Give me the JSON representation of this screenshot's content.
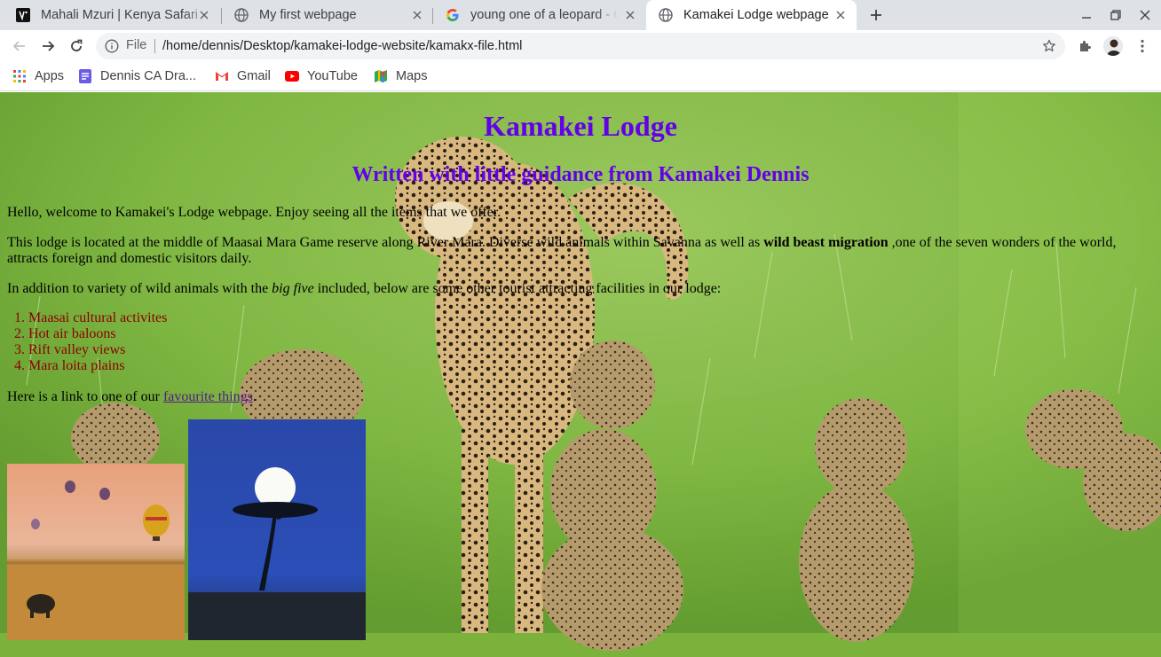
{
  "browser": {
    "tabs": [
      {
        "title": "Mahali Mzuri | Kenya Safari",
        "favicon": "virgin-favicon"
      },
      {
        "title": "My first webpage",
        "favicon": "globe-icon"
      },
      {
        "title": "young one of a leopard - Google Search",
        "favicon": "google-icon"
      },
      {
        "title": "Kamakei Lodge webpage",
        "favicon": "globe-icon",
        "active": true
      }
    ],
    "address": {
      "scheme": "File",
      "url": "/home/dennis/Desktop/kamakei-lodge-website/kamakx-file.html"
    },
    "bookmarks": [
      {
        "label": "Apps",
        "icon": "apps-grid-icon"
      },
      {
        "label": "Dennis CA Dra...",
        "icon": "docs-icon"
      },
      {
        "label": "Gmail",
        "icon": "gmail-icon"
      },
      {
        "label": "YouTube",
        "icon": "youtube-icon"
      },
      {
        "label": "Maps",
        "icon": "maps-icon"
      }
    ]
  },
  "page": {
    "heading": "Kamakei Lodge",
    "subheading": "Written with little guidance from Kamakei Dennis",
    "intro": "Hello, welcome to Kamakei's Lodge webpage. Enjoy seeing all the items that we offer.",
    "location_before": "This lodge is located at the middle of Maasai Mara Game reserve along River Mara. Diverse wild animals within Savanna as well as ",
    "location_bold": "wild beast migration",
    "location_after": " ,one of the seven wonders of the world, attracts foreign and domestic visitors daily.",
    "addition_before": "In addition to variety of wild animals with the ",
    "addition_italic": "big five",
    "addition_after": " included, below are some other tourist attracting facilities in our lodge:",
    "facilities": [
      {
        "num": "1.",
        "text": "Maasai cultural activites"
      },
      {
        "num": "2.",
        "text": "Hot air baloons"
      },
      {
        "num": "3.",
        "text": "Rift valley views"
      },
      {
        "num": "4.",
        "text": "Mara loita plains"
      }
    ],
    "link_before": "Here is a link to one of our ",
    "link_text": "favourite things",
    "link_after": ".",
    "colors": {
      "heading": "#6200ea",
      "list": "#8b0000",
      "link": "#551a8b"
    }
  }
}
